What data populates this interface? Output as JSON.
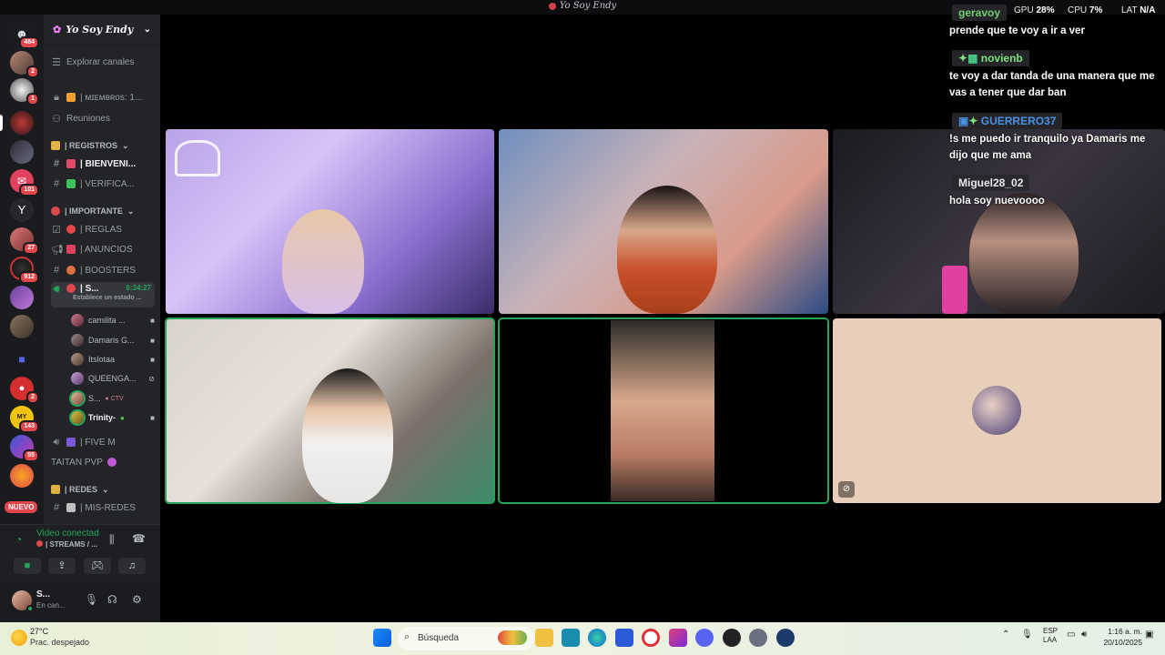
{
  "window": {
    "title": "Yo Soy Endy"
  },
  "rail": {
    "badges": [
      "484",
      "2",
      "1",
      "101",
      "27",
      "912",
      "2",
      "143",
      "55"
    ],
    "new_label": "NUEVO"
  },
  "server": {
    "name": "Yo Soy Endy",
    "explore": "Explorar canales",
    "members_channel": "| ᴍɪᴇᴍʙʀᴏs: 1...",
    "meetings": "Reuniones",
    "cat_registros": "| REGISTROS",
    "ch_bienvenida": "| BIENVENI...",
    "ch_verifica": "| VERIFICA...",
    "cat_importante": "| IMPORTANTE",
    "ch_reglas": "| REGLAS",
    "ch_anuncios": "| ANUNCIOS",
    "ch_boosters": "| BOOSTERS",
    "voice_active": "| S...",
    "voice_time": "6:34:27",
    "voice_sub": "Establece un estado ...",
    "members": [
      "camilita ...",
      "Damaris G...",
      "Itslotaa",
      "QUEENGA...",
      "S...",
      "Trinity-"
    ],
    "ch_fivem": "| FIVE M",
    "ch_taitan": "TAITAN PVP",
    "cat_redes": "| REDES",
    "ch_misredes": "| MIS-REDES"
  },
  "voice_panel": {
    "status": "Video conectad",
    "channel": "| STREAMS / ..."
  },
  "user": {
    "name": "S...",
    "status": "En can..."
  },
  "chat": [
    {
      "user": "geravoy",
      "color": "#6fd16f",
      "text": "prende que te voy a ir a ver"
    },
    {
      "user": "novienb",
      "color": "#7ee07e",
      "text": "te voy a dar tanda de una manera que me vas a tener que dar ban"
    },
    {
      "user": "GUERRERO37",
      "color": "#4a90e2",
      "text": "!s me puedo ir tranquilo ya Damaris me dijo que me ama"
    },
    {
      "user": "Miguel28_02",
      "color": "#e8e8e8",
      "text": "hola soy nuevoooo"
    }
  ],
  "hud": {
    "gpu_label": "GPU",
    "gpu_val": "28%",
    "cpu_label": "CPU",
    "cpu_val": "7%",
    "lat_label": "LAT",
    "lat_val": "N/A"
  },
  "taskbar": {
    "temp": "27°C",
    "weather": "Prac. despejado",
    "search_placeholder": "Búsqueda",
    "lang1": "ESP",
    "lang2": "LAA",
    "time": "1:16 a. m.",
    "date": "20/10/2025"
  }
}
